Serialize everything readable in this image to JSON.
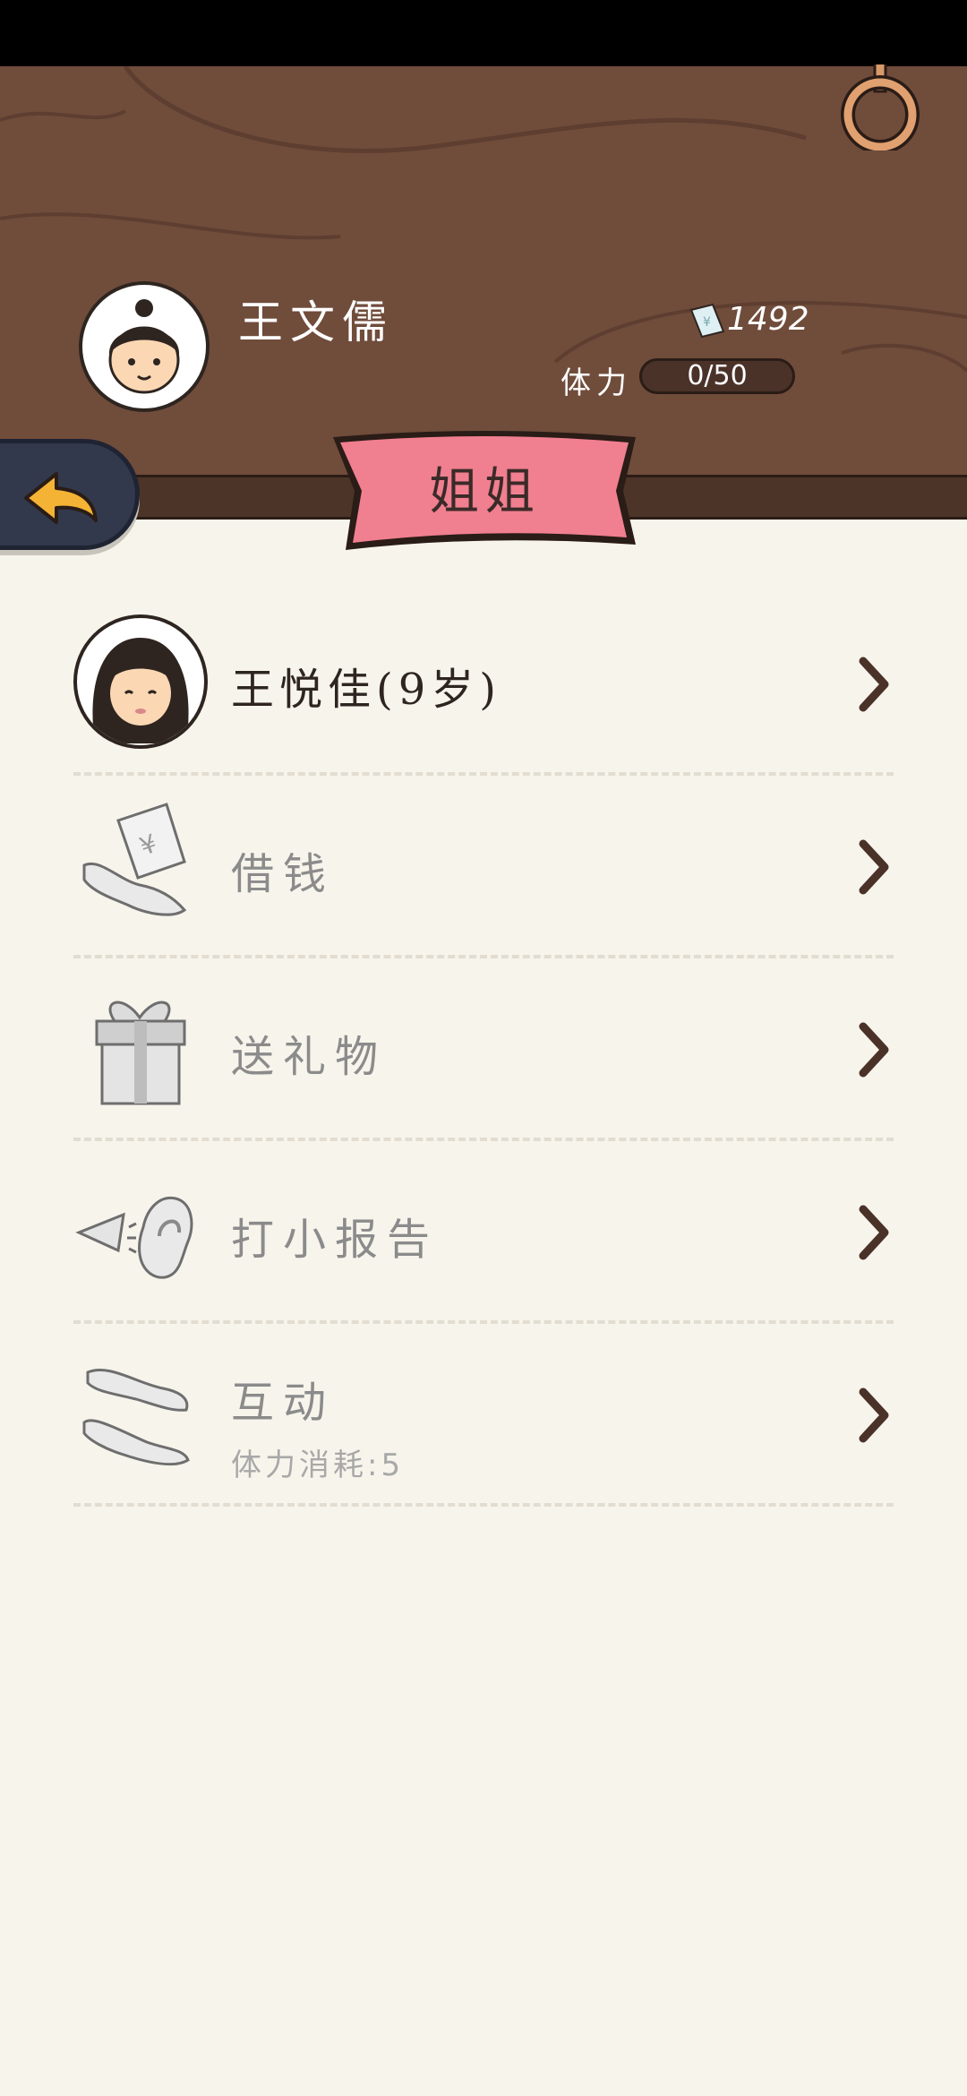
{
  "player": {
    "name": "王文儒",
    "money": "1492",
    "stamina_label": "体力",
    "stamina_value": "0/50"
  },
  "page": {
    "title": "姐姐"
  },
  "menu": [
    {
      "label": "王悦佳(9岁)"
    },
    {
      "label": "借钱"
    },
    {
      "label": "送礼物"
    },
    {
      "label": "打小报告"
    },
    {
      "label": "互动",
      "sub": "体力消耗:5"
    }
  ]
}
